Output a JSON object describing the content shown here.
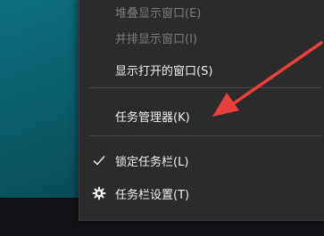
{
  "menu": {
    "items": [
      {
        "label": "堆叠显示窗口(E)",
        "enabled": false
      },
      {
        "label": "并排显示窗口(I)",
        "enabled": false
      },
      {
        "label": "显示打开的窗口(S)",
        "enabled": true
      },
      {
        "label": "任务管理器(K)",
        "enabled": true
      },
      {
        "label": "锁定任务栏(L)",
        "enabled": true,
        "checked": true
      },
      {
        "label": "任务栏设置(T)",
        "enabled": true,
        "icon": "gear-icon"
      }
    ]
  },
  "annotation": {
    "arrow_color": "#e8413d"
  },
  "colors": {
    "menu_bg": "#2b2b2b",
    "text": "#f0f0f0",
    "disabled_text": "#7d7d7d",
    "desktop": "#0a5e6c",
    "taskbar": "#101216"
  }
}
